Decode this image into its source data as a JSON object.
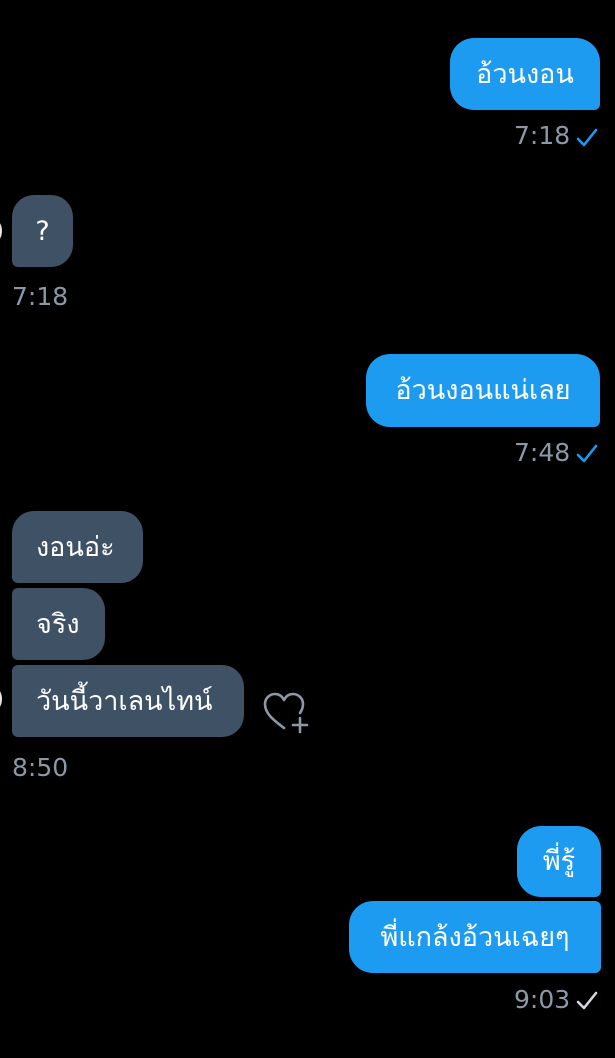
{
  "messages": [
    {
      "id": "m1",
      "direction": "outgoing",
      "text": "อ้วนงอน"
    },
    {
      "id": "m2",
      "direction": "incoming",
      "text": "?"
    },
    {
      "id": "m3",
      "direction": "outgoing",
      "text": "อ้วนงอนแน่เลย"
    },
    {
      "id": "m4",
      "direction": "incoming",
      "text": "งอนอ่ะ"
    },
    {
      "id": "m5",
      "direction": "incoming",
      "text": "จริง"
    },
    {
      "id": "m6",
      "direction": "incoming",
      "text": "วันนี้วาเลนไทน์"
    },
    {
      "id": "m7",
      "direction": "outgoing",
      "text": "พี่รู้"
    },
    {
      "id": "m8",
      "direction": "outgoing",
      "text": "พี่แกล้งอ้วนเฉยๆ"
    }
  ],
  "timestamps": {
    "t1": "7:18",
    "t2": "7:18",
    "t3": "7:48",
    "t4": "8:50",
    "t5": "9:03"
  },
  "icons": {
    "read_check": "check-icon",
    "react": "heart-plus-icon"
  },
  "colors": {
    "background": "#000000",
    "outgoing_bubble": "#1d9bf0",
    "incoming_bubble": "#3e5165",
    "timestamp": "#8b98a5",
    "read_check": "#1d9bf0",
    "sent_check": "#cfd9de"
  }
}
